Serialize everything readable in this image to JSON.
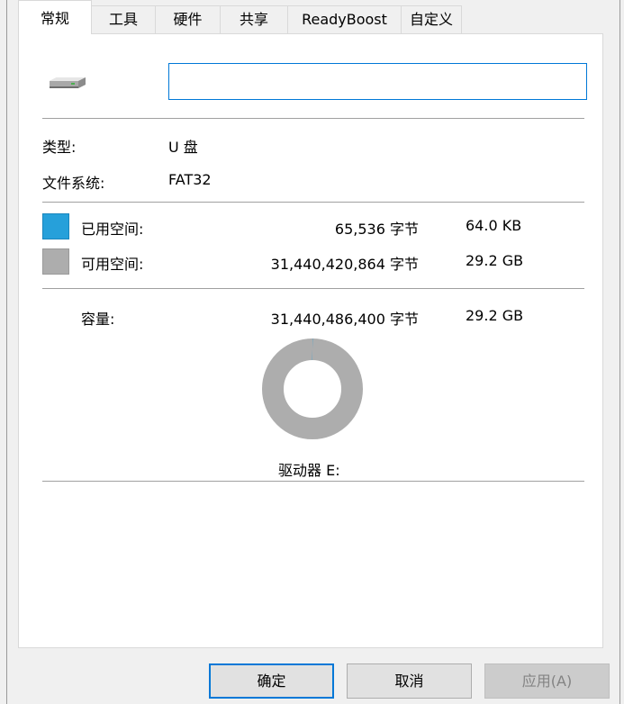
{
  "tabs": [
    {
      "label": "常规",
      "active": true
    },
    {
      "label": "工具",
      "active": false
    },
    {
      "label": "硬件",
      "active": false
    },
    {
      "label": "共享",
      "active": false
    },
    {
      "label": "ReadyBoost",
      "active": false
    },
    {
      "label": "自定义",
      "active": false
    }
  ],
  "drive": {
    "name_value": "",
    "icon": "usb-drive-icon",
    "type_label": "类型:",
    "type_value": "U 盘",
    "fs_label": "文件系统:",
    "fs_value": "FAT32"
  },
  "space": {
    "used_label": "已用空间:",
    "used_bytes": "65,536 字节",
    "used_size": "64.0 KB",
    "free_label": "可用空间:",
    "free_bytes": "31,440,420,864 字节",
    "free_size": "29.2 GB",
    "capacity_label": "容量:",
    "capacity_bytes": "31,440,486,400 字节",
    "capacity_size": "29.2 GB",
    "used_color": "#26a0da",
    "free_color": "#adadad",
    "used_fraction": 2.1e-06
  },
  "drive_label": "驱动器 E:",
  "buttons": {
    "ok": "确定",
    "cancel": "取消",
    "apply": "应用(A)"
  }
}
